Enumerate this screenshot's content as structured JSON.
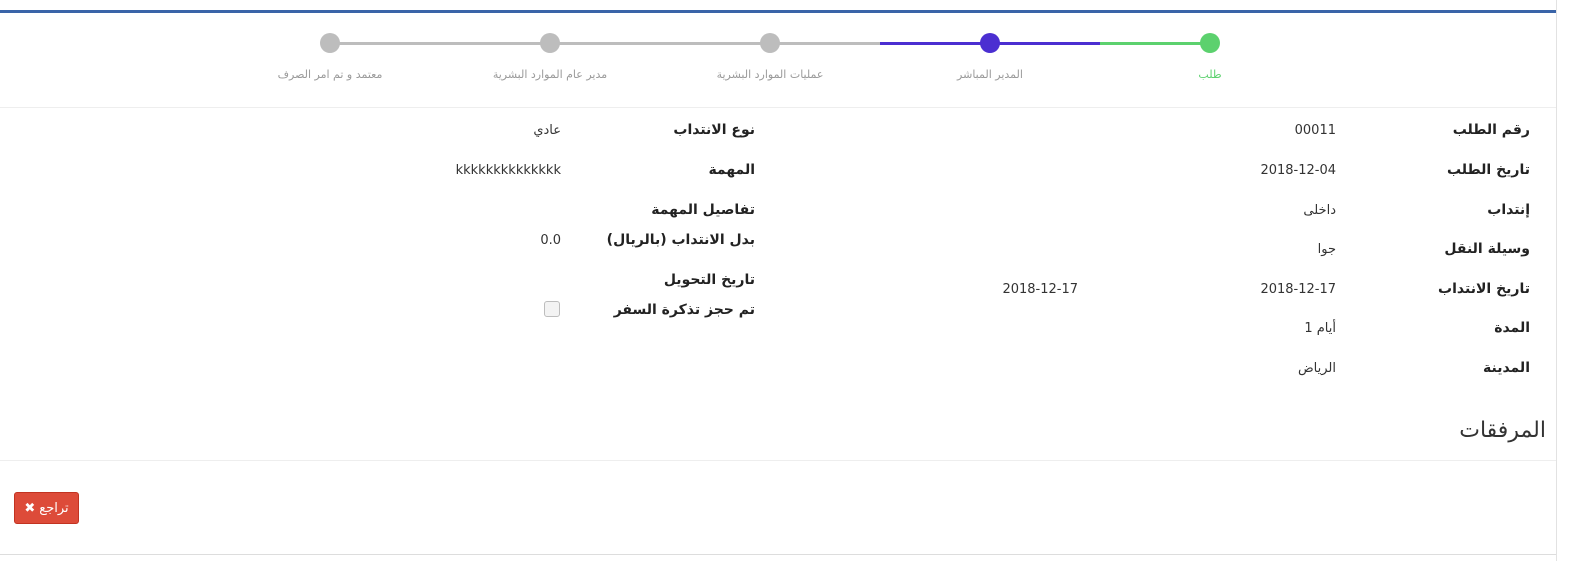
{
  "colors": {
    "done": "#5cd16e",
    "active": "#4b2fd1",
    "pending": "#bdbdbd",
    "header_border": "#3a64a8",
    "danger": "#dd4b39"
  },
  "stepper": {
    "steps": [
      {
        "label": "طلب",
        "state": "done"
      },
      {
        "label": "المدير المباشر",
        "state": "active"
      },
      {
        "label": "عمليات الموارد البشرية",
        "state": "pending"
      },
      {
        "label": "مدير عام الموارد البشرية",
        "state": "pending"
      },
      {
        "label": "معتمد و تم امر الصرف",
        "state": "pending"
      }
    ]
  },
  "details": {
    "request_number": {
      "label": "رقم الطلب",
      "value": "00011"
    },
    "request_date": {
      "label": "تاريخ الطلب",
      "value": "2018-12-04"
    },
    "assignment": {
      "label": "إنتداب",
      "value": "داخلى"
    },
    "transport": {
      "label": "وسيلة النقل",
      "value": "جوا"
    },
    "assignment_date": {
      "label": "تاريخ الانتداب",
      "value": "2018-12-17",
      "value_end": "2018-12-17"
    },
    "duration": {
      "label": "المدة",
      "value": "1 أيام"
    },
    "city": {
      "label": "المدينة",
      "value": "الرياض"
    },
    "assignment_type": {
      "label": "نوع الانتداب",
      "value": "عادي"
    },
    "task": {
      "label": "المهمة",
      "value": "kkkkkkkkkkkkkk"
    },
    "task_details": {
      "label": "تفاصيل المهمة",
      "value": ""
    },
    "allowance": {
      "label": "بدل الانتداب (بالريال)",
      "value": "0.0"
    },
    "transfer_date": {
      "label": "تاريخ التحويل",
      "value": ""
    },
    "ticket_booked": {
      "label": "تم حجز تذكرة السفر",
      "checked": false
    }
  },
  "attachments": {
    "title": "المرفقات"
  },
  "actions": {
    "back_label": "تراجع"
  },
  "icons": {
    "back": "close-icon"
  }
}
